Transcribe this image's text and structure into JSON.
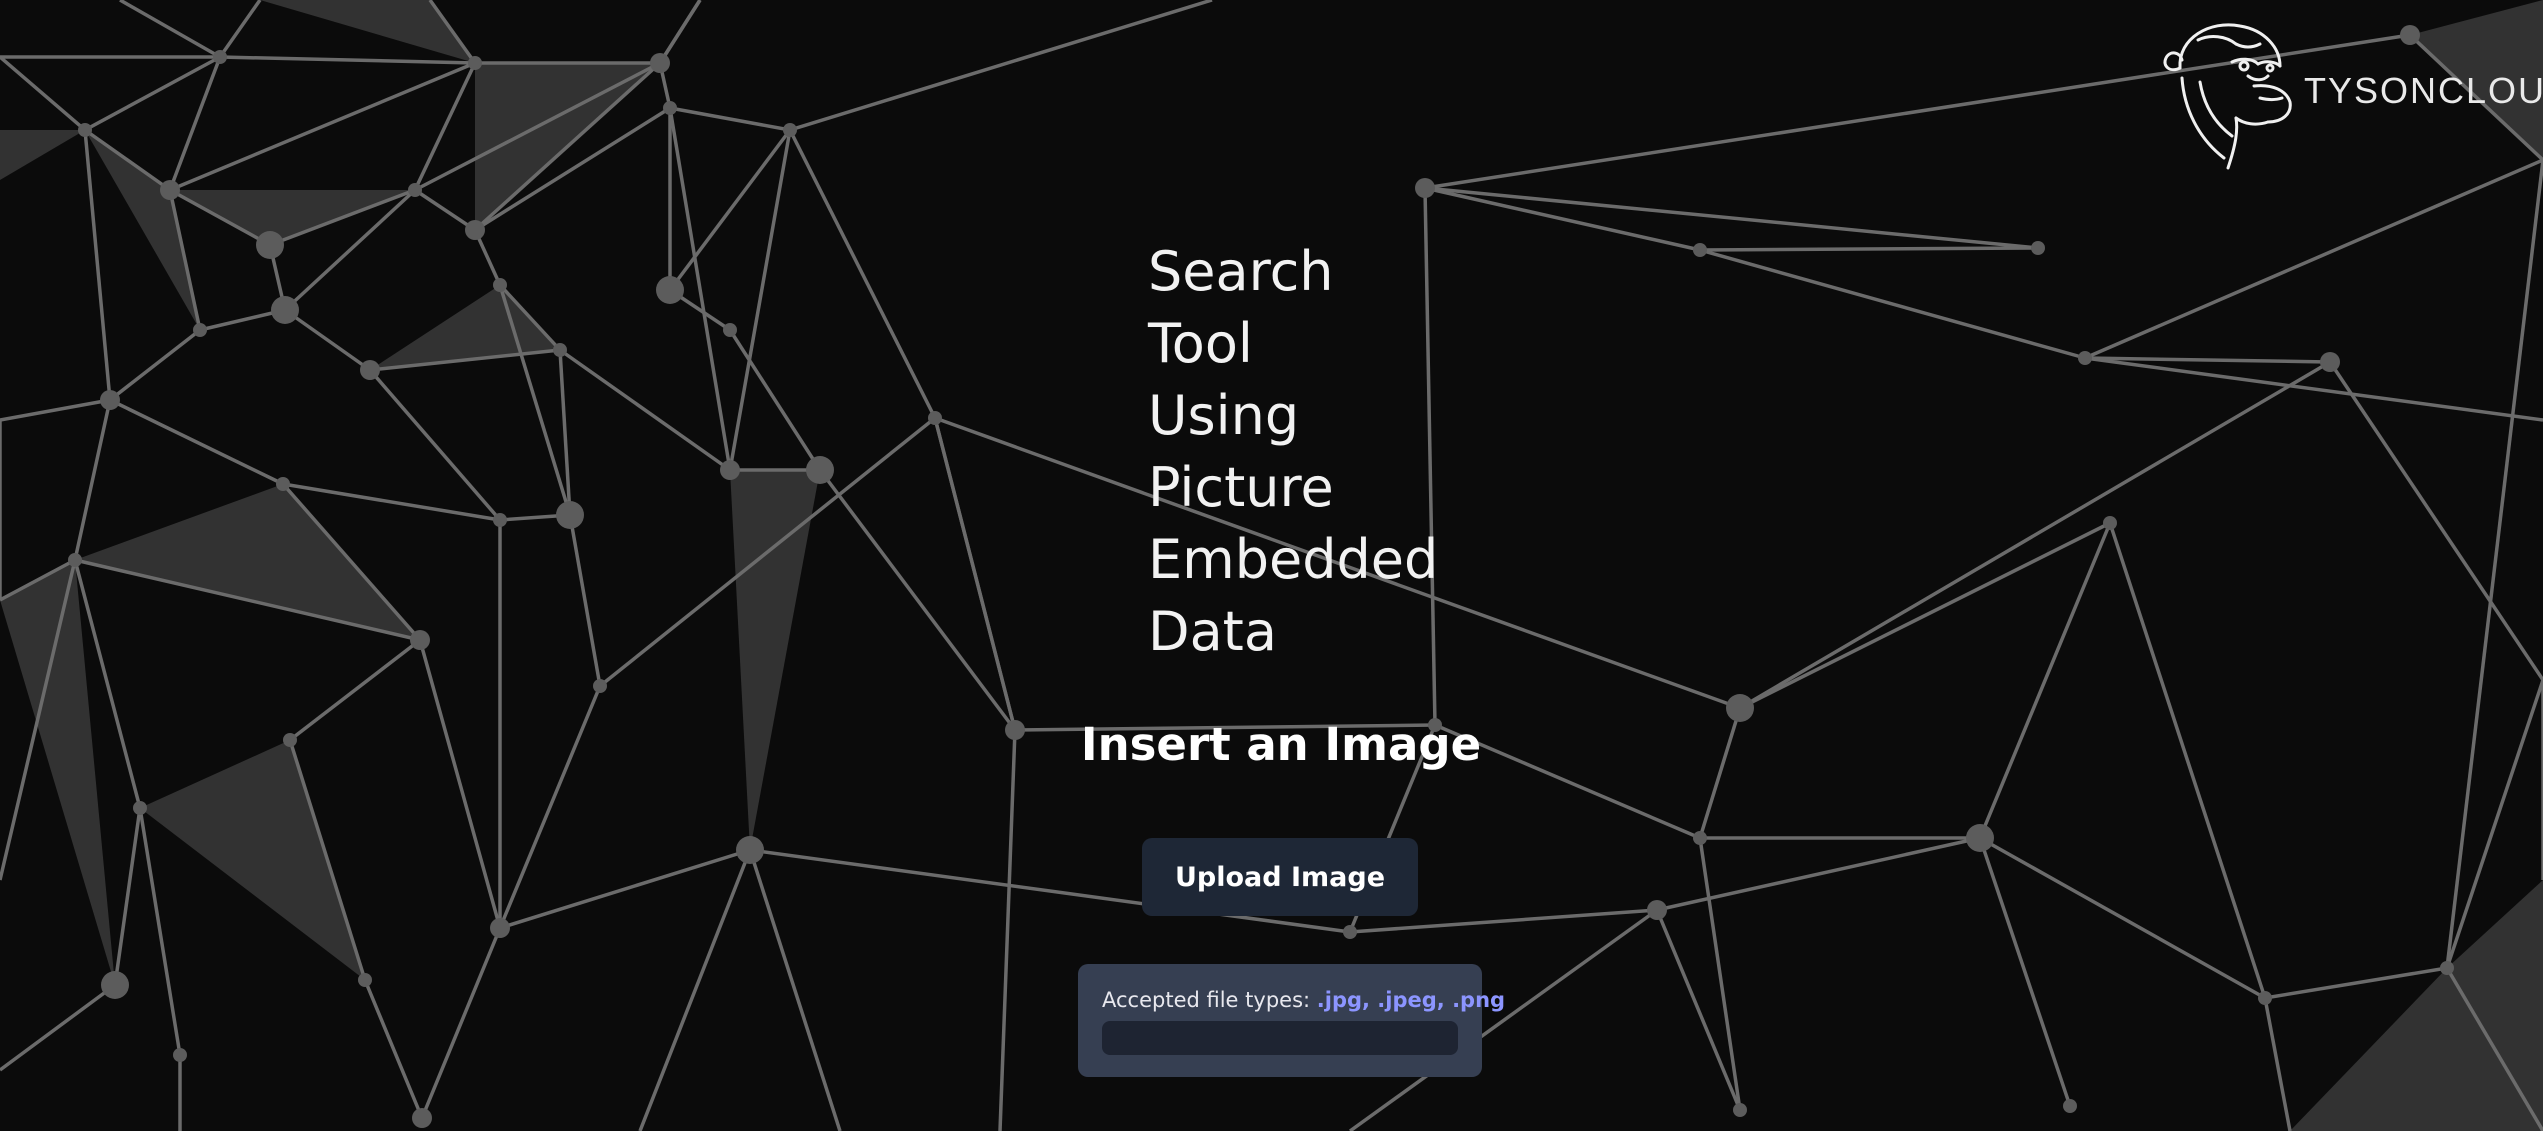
{
  "brand": {
    "name": "TYSONCLOUD",
    "logo_icon": "gorilla-head-icon"
  },
  "headline": {
    "words": [
      "Search",
      "Tool",
      "Using",
      "Picture",
      "Embedded",
      "Data"
    ]
  },
  "upload": {
    "title": "Insert an Image",
    "button_label": "Upload Image",
    "accepted_label": "Accepted file types:",
    "accepted_types": ".jpg, .jpeg, .png"
  },
  "colors": {
    "background": "#0b0b0b",
    "network_lines": "#6b6b6b",
    "button": "#1e2736",
    "file_box": "#363f52",
    "accent_link": "#8c95ff"
  }
}
